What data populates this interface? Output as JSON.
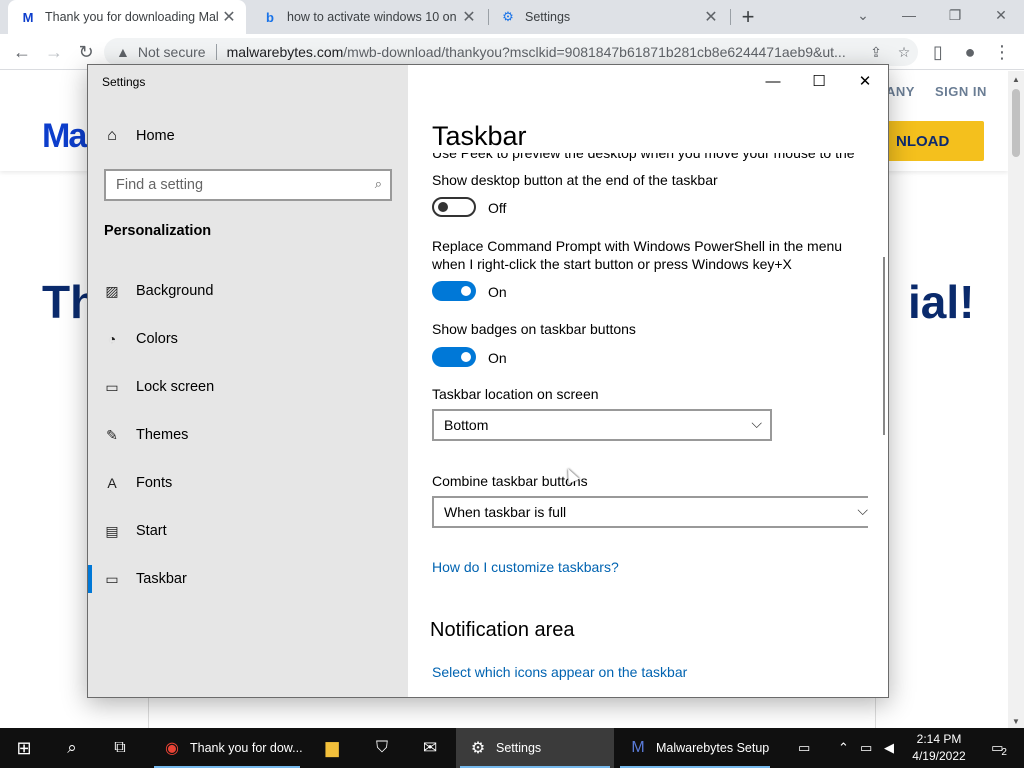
{
  "browser": {
    "tabs": [
      {
        "title": "Thank you for downloading Malwarebytes",
        "favicon": "M",
        "favicon_color": "#0d3ecc",
        "active": true
      },
      {
        "title": "how to activate windows 10 on",
        "favicon": "b",
        "favicon_color": "#1a73e8",
        "active": false
      },
      {
        "title": "Settings",
        "favicon": "gear",
        "favicon_color": "#1a73e8",
        "active": false
      }
    ],
    "new_tab": "+",
    "not_secure": "Not secure",
    "url_host": "malwarebytes.com",
    "url_path": "/mwb-download/thankyou?msclkid=9081847b61871b281cb8e6244471aeb9&ut..."
  },
  "page": {
    "nav_left": "ANY",
    "nav_right": "SIGN IN",
    "logo_text": "Ma",
    "download_btn": "NLOAD",
    "headline_left": "Th",
    "headline_right": "ial!"
  },
  "settings": {
    "window_title": "Settings",
    "home": "Home",
    "search_placeholder": "Find a setting",
    "section": "Personalization",
    "nav": [
      {
        "label": "Background",
        "icon": "image-icon",
        "selected": false
      },
      {
        "label": "Colors",
        "icon": "palette-icon",
        "selected": false
      },
      {
        "label": "Lock screen",
        "icon": "lock-screen-icon",
        "selected": false
      },
      {
        "label": "Themes",
        "icon": "themes-icon",
        "selected": false
      },
      {
        "label": "Fonts",
        "icon": "fonts-icon",
        "selected": false
      },
      {
        "label": "Start",
        "icon": "start-icon",
        "selected": false
      },
      {
        "label": "Taskbar",
        "icon": "taskbar-icon",
        "selected": true
      }
    ],
    "page_title": "Taskbar",
    "peek_text_1": "Use Peek to preview the desktop when you move your mouse to the",
    "peek_text_2": "Show desktop button at the end of the taskbar",
    "peek_toggle": "Off",
    "powershell_text_1": "Replace Command Prompt with Windows PowerShell in the menu",
    "powershell_text_2": "when I right-click the start button or press Windows key+X",
    "powershell_toggle": "On",
    "badges_text": "Show badges on taskbar buttons",
    "badges_toggle": "On",
    "location_label": "Taskbar location on screen",
    "location_value": "Bottom",
    "combine_label": "Combine taskbar buttons",
    "combine_value": "When taskbar is full",
    "customize_link": "How do I customize taskbars?",
    "notification_heading": "Notification area",
    "notification_link": "Select which icons appear on the taskbar"
  },
  "taskbar": {
    "chrome_item": "Thank you for dow...",
    "settings_item": "Settings",
    "malwarebytes_item": "Malwarebytes Setup",
    "time": "2:14 PM",
    "date": "4/19/2022",
    "notifications": "2"
  }
}
